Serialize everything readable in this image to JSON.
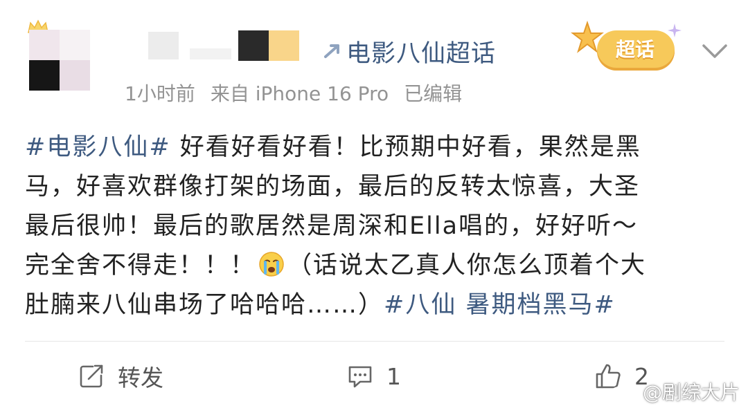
{
  "header": {
    "supertopic_link": "电影八仙超话",
    "badge_label": "超话",
    "meta": {
      "time": "1小时前",
      "source": "来自 iPhone 16 Pro",
      "edited": "已编辑"
    }
  },
  "post": {
    "lines": [
      [
        {
          "type": "tag",
          "text": "#电影八仙#"
        },
        {
          "type": "text",
          "text": " 好看好看好看！比预期中好看，果然是黑"
        }
      ],
      [
        {
          "type": "text",
          "text": "马，好喜欢群像打架的场面，最后的反转太惊喜，大圣"
        }
      ],
      [
        {
          "type": "text",
          "text": "最后很帅！最后的歌居然是周深和Ella唱的，好好听～"
        }
      ],
      [
        {
          "type": "text",
          "text": "完全舍不得走！！！"
        },
        {
          "type": "emoji",
          "name": "crying-face-icon"
        },
        {
          "type": "text",
          "text": "（话说太乙真人你怎么顶着个大"
        }
      ],
      [
        {
          "type": "text",
          "text": "肚腩来八仙串场了哈哈哈……）"
        },
        {
          "type": "tag",
          "text": "#八仙 暑期档黑马#"
        }
      ]
    ]
  },
  "actions": {
    "repost_label": "转发",
    "comment_count": "1",
    "like_count": "2"
  },
  "watermark": {
    "text": "@剧综大片",
    "icon": "weibo-logo-icon"
  },
  "icons": {
    "supertopic": "supertopic-arrow-icon",
    "expand": "chevron-down-icon",
    "repost": "repost-icon",
    "comment": "comment-icon",
    "like": "thumbs-up-icon"
  },
  "colors": {
    "link": "#3e5a80",
    "text": "#222222",
    "meta": "#939393",
    "badge": "#f7c95a",
    "divider": "#e6e6e6"
  }
}
